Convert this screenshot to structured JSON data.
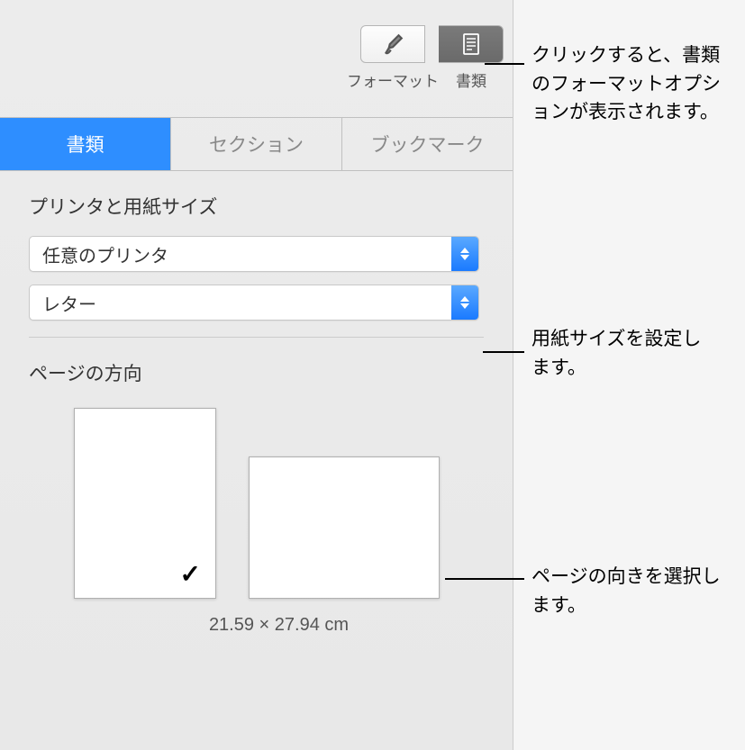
{
  "toolbar": {
    "format_label": "フォーマット",
    "document_label": "書類"
  },
  "tabs": {
    "document": "書類",
    "section": "セクション",
    "bookmark": "ブックマーク"
  },
  "printer_section": {
    "title": "プリンタと用紙サイズ",
    "printer_value": "任意のプリンタ",
    "paper_value": "レター"
  },
  "orientation_section": {
    "title": "ページの方向",
    "page_size": "21.59 × 27.94 cm"
  },
  "callouts": {
    "c1": "クリックすると、書類のフォーマットオプションが表示されます。",
    "c2": "用紙サイズを設定します。",
    "c3": "ページの向きを選択します。"
  }
}
